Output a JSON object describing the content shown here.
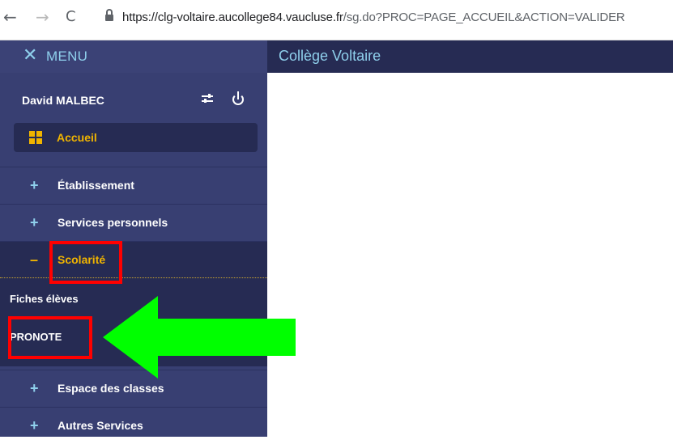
{
  "browser": {
    "back_icon": "←",
    "forward_icon": "→",
    "reload_icon": "C",
    "url_host": "https://clg-voltaire.aucollege84.vaucluse.fr",
    "url_path": "/sg.do?PROC=PAGE_ACCUEIL&ACTION=VALIDER"
  },
  "header": {
    "close_icon": "✕",
    "menu_label": "MENU",
    "title": "Collège Voltaire"
  },
  "user": {
    "name": "David MALBEC"
  },
  "sidebar": {
    "home_label": "Accueil",
    "sections": [
      {
        "label": "Établissement",
        "toggle": "+"
      },
      {
        "label": "Services personnels",
        "toggle": "+"
      },
      {
        "label": "Scolarité",
        "toggle": "–"
      },
      {
        "label": "Espace des classes",
        "toggle": "+"
      },
      {
        "label": "Autres Services",
        "toggle": "+"
      }
    ],
    "scolarite_items": [
      {
        "label": "Fiches élèves"
      },
      {
        "label": "PRONOTE"
      }
    ]
  },
  "colors": {
    "header_bg": "#262b53",
    "sidebar_bg": "#383f72",
    "accent": "#f0b400",
    "link_blue": "#8fd0ec",
    "annotation_red": "#ff0000",
    "annotation_arrow": "#00ff00"
  }
}
